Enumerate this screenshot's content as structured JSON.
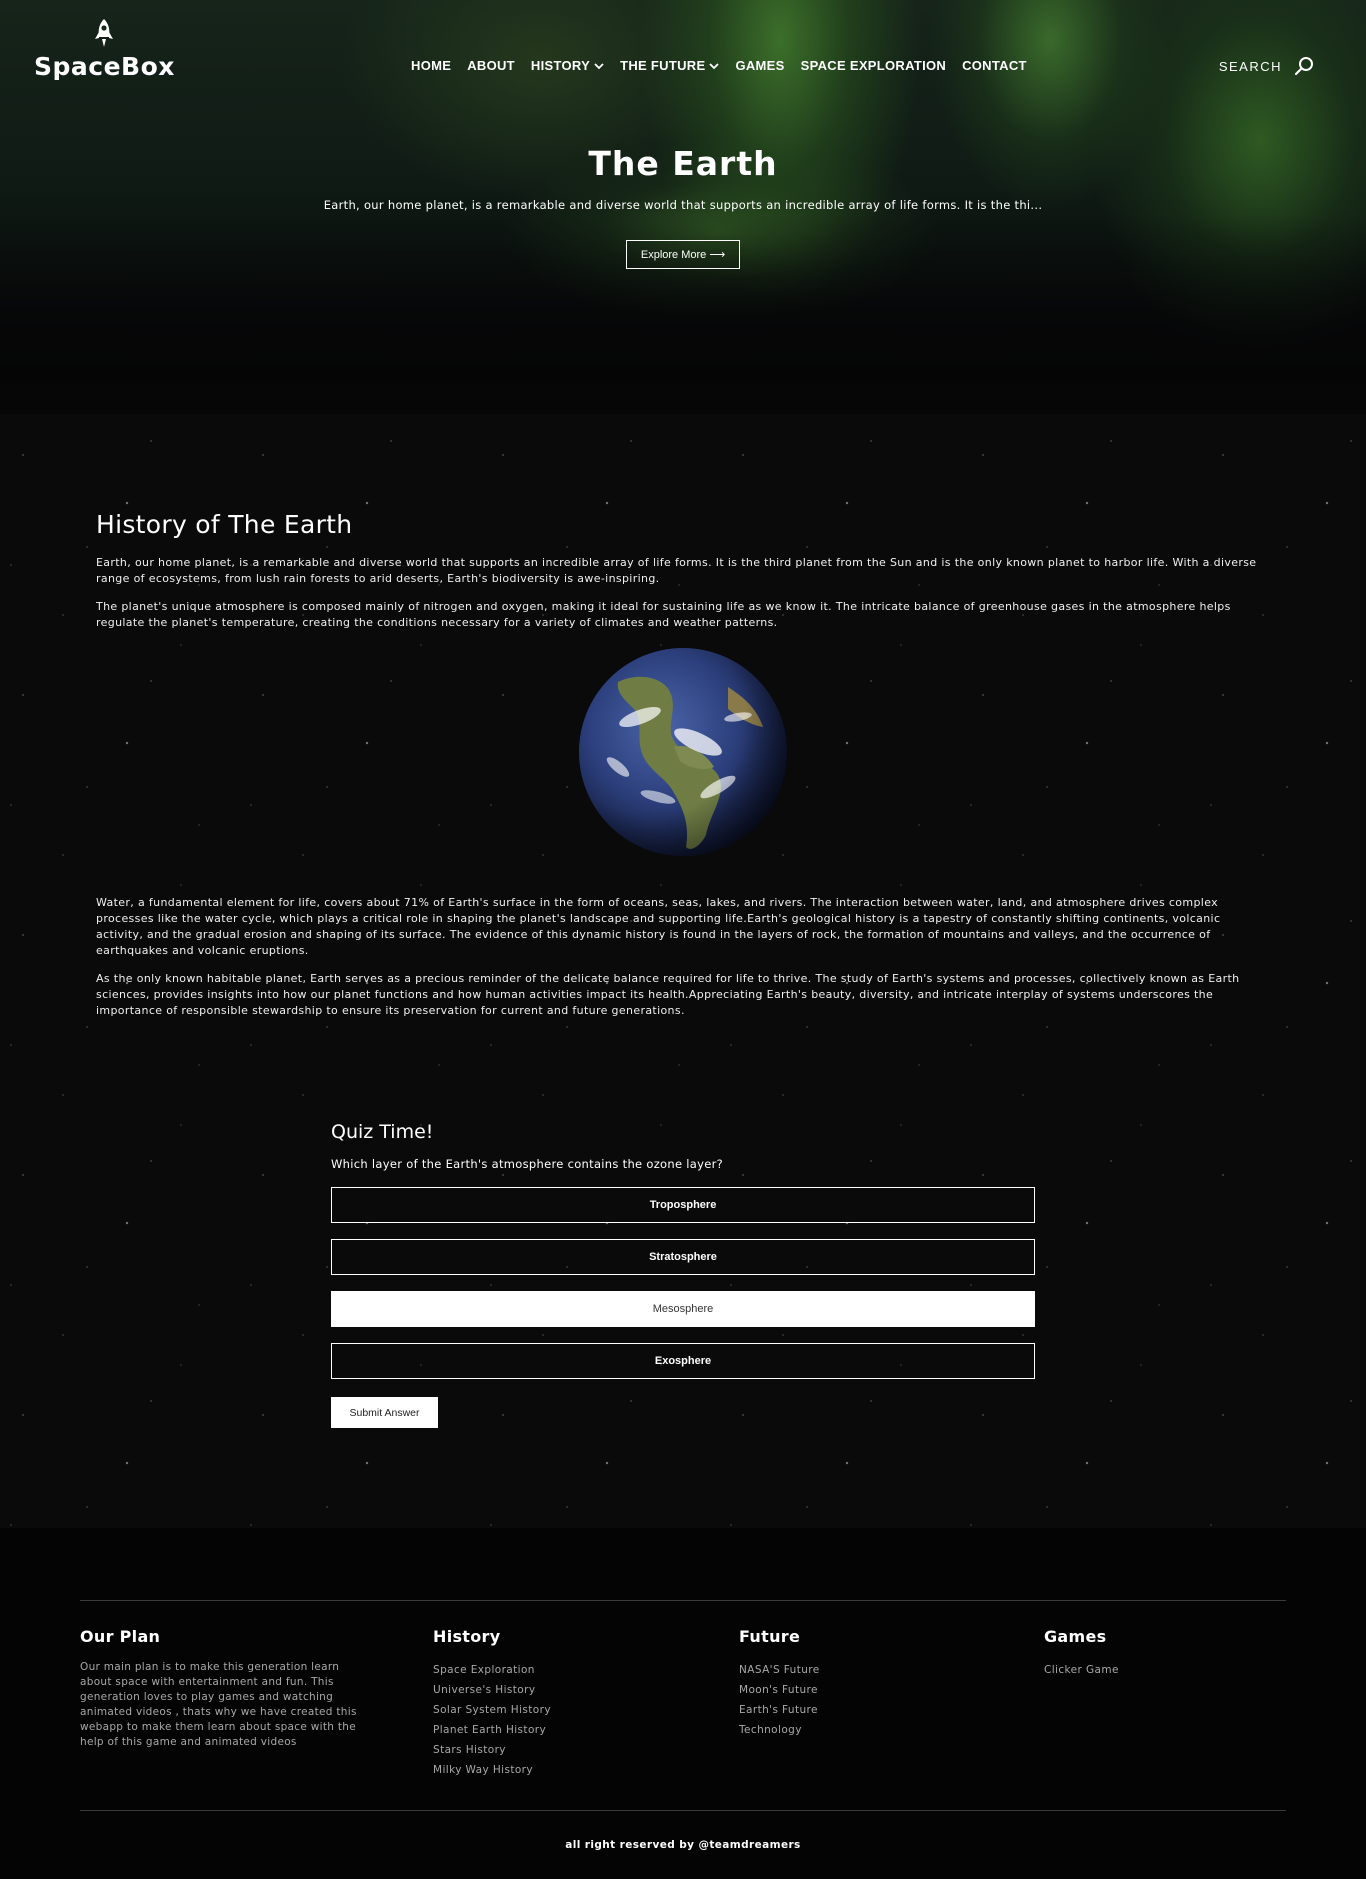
{
  "header": {
    "brand": "SpaceBox",
    "nav": [
      {
        "label": "HOME",
        "has_dropdown": false
      },
      {
        "label": "ABOUT",
        "has_dropdown": false
      },
      {
        "label": "HISTORY",
        "has_dropdown": true
      },
      {
        "label": "THE FUTURE",
        "has_dropdown": true
      },
      {
        "label": "GAMES",
        "has_dropdown": false
      },
      {
        "label": "SPACE EXPLORATION",
        "has_dropdown": false
      },
      {
        "label": "CONTACT",
        "has_dropdown": false
      }
    ],
    "search_label": "SEARCH",
    "chevron_glyph": "⌄",
    "search_icon": "magnifier-icon"
  },
  "hero": {
    "title": "The Earth",
    "subtitle": "Earth, our home planet, is a remarkable and diverse world that supports an incredible array of life forms. It is the thi...",
    "button_label": "Explore More ⟶"
  },
  "history": {
    "title": "History of The Earth",
    "paragraphs_top": [
      "Earth, our home planet, is a remarkable and diverse world that supports an incredible array of life forms. It is the third planet from the Sun and is the only known planet to harbor life. With a diverse range of ecosystems, from lush rain forests to arid deserts, Earth's biodiversity is awe-inspiring.",
      "The planet's unique atmosphere is composed mainly of nitrogen and oxygen, making it ideal for sustaining life as we know it. The intricate balance of greenhouse gases in the atmosphere helps regulate the planet's temperature, creating the conditions necessary for a variety of climates and weather patterns."
    ],
    "paragraphs_bottom": [
      "Water, a fundamental element for life, covers about 71% of Earth's surface in the form of oceans, seas, lakes, and rivers. The interaction between water, land, and atmosphere drives complex processes like the water cycle, which plays a critical role in shaping the planet's landscape and supporting life.Earth's geological history is a tapestry of constantly shifting continents, volcanic activity, and the gradual erosion and shaping of its surface. The evidence of this dynamic history is found in the layers of rock, the formation of mountains and valleys, and the occurrence of earthquakes and volcanic eruptions.",
      "As the only known habitable planet, Earth serves as a precious reminder of the delicate balance required for life to thrive. The study of Earth's systems and processes, collectively known as Earth sciences, provides insights into how our planet functions and how human activities impact its health.Appreciating Earth's beauty, diversity, and intricate interplay of systems underscores the importance of responsible stewardship to ensure its preservation for current and future generations."
    ]
  },
  "quiz": {
    "title": "Quiz Time!",
    "question": "Which layer of the Earth's atmosphere contains the ozone layer?",
    "options": [
      "Troposphere",
      "Stratosphere",
      "Mesosphere",
      "Exosphere"
    ],
    "selected_option": "Mesosphere",
    "submit_label": "Submit Answer"
  },
  "footer": {
    "plan": {
      "title": "Our Plan",
      "text": "Our main plan is to make this generation learn about space with entertainment and fun. This generation loves to play games and watching animated videos , thats why we have created this webapp to make them learn about space with the help of this game and animated videos"
    },
    "history": {
      "title": "History",
      "links": [
        "Space Exploration",
        "Universe's History",
        "Solar System History",
        "Planet Earth History",
        "Stars History",
        "Milky Way History"
      ]
    },
    "future": {
      "title": "Future",
      "links": [
        "NASA'S Future",
        "Moon's Future",
        "Earth's Future",
        "Technology"
      ]
    },
    "games": {
      "title": "Games",
      "links": [
        "Clicker Game"
      ]
    },
    "copyright": "all right reserved by @teamdreamers"
  },
  "colors": {
    "background": "#000000",
    "text": "#ffffff",
    "muted_text": "#a8a8a8",
    "selected_option_bg": "#ffffff",
    "earth_ocean": "#2f4f8f",
    "earth_land": "#7a8a4a"
  }
}
